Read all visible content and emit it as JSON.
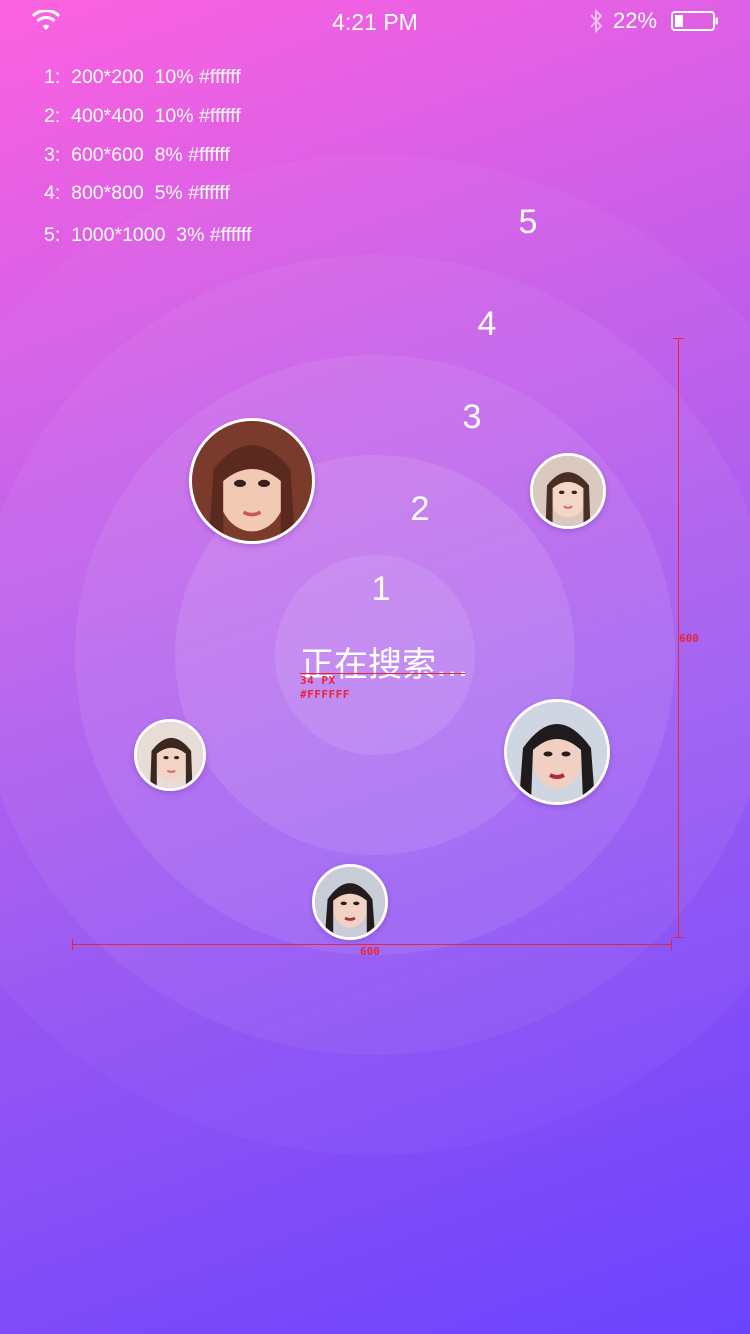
{
  "status_bar": {
    "time": "4:21 PM",
    "battery_percent": "22%",
    "battery_level": 0.22,
    "icons": [
      "wifi-icon",
      "bluetooth-icon",
      "battery-icon"
    ]
  },
  "spec_notes": [
    "1:  200*200  10% #ffffff",
    "2:  400*400  10% #ffffff",
    "3:  600*600  8% #ffffff",
    "4:  800*800  5% #ffffff",
    "5:  1000*1000  3% #ffffff"
  ],
  "ring_labels": [
    "1",
    "2",
    "3",
    "4",
    "5"
  ],
  "search": {
    "label": "正在搜索...",
    "font_spec": "34 PX",
    "color_spec": "#FFFFFF"
  },
  "dimensions": {
    "width_label": "600",
    "height_label": "600"
  },
  "colors": {
    "gradient_top": "#fd62e0",
    "gradient_bottom": "#6a43fd",
    "ring": "#ffffff",
    "annotation_red": "#e7263a"
  }
}
